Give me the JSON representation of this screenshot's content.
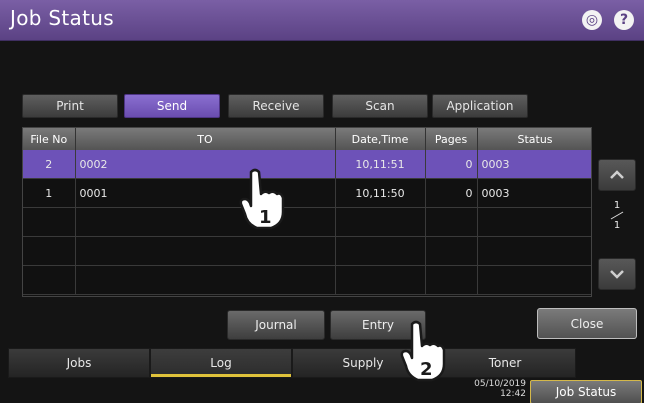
{
  "window": {
    "title": "Job Status",
    "icons": [
      {
        "name": "globe-icon",
        "glyph": "◎"
      },
      {
        "name": "help-icon",
        "glyph": "?"
      }
    ]
  },
  "top_tabs": [
    {
      "label": "Print",
      "active": false
    },
    {
      "label": "Send",
      "active": true
    },
    {
      "label": "Receive",
      "active": false
    },
    {
      "label": "Scan",
      "active": false
    },
    {
      "label": "Application",
      "active": false
    }
  ],
  "table": {
    "columns": [
      "File No",
      "TO",
      "Date,Time",
      "Pages",
      "Status"
    ],
    "rows": [
      {
        "file_no": "2",
        "to": "0002",
        "date_time": "10,11:51",
        "pages": "0",
        "status": "0003",
        "selected": true
      },
      {
        "file_no": "1",
        "to": "0001",
        "date_time": "10,11:50",
        "pages": "0",
        "status": "0003",
        "selected": false
      }
    ],
    "empty_rows": 3
  },
  "pager": {
    "current": "1",
    "total": "1"
  },
  "actions": {
    "journal": "Journal",
    "entry": "Entry",
    "close": "Close"
  },
  "bottom_tabs": [
    {
      "label": "Jobs",
      "active": false
    },
    {
      "label": "Log",
      "active": true
    },
    {
      "label": "Supply",
      "active": false
    },
    {
      "label": "Toner",
      "active": false
    }
  ],
  "status_bar": {
    "date": "05/10/2019",
    "time": "12:42",
    "job_status_button": "Job Status"
  },
  "callouts": [
    {
      "number": "1",
      "name": "pointer-hand-icon"
    },
    {
      "number": "2",
      "name": "pointer-hand-icon"
    }
  ],
  "colors": {
    "accent_purple": "#6d52b8",
    "title_purple": "#6a4f96",
    "active_underline": "#e0c33b",
    "job_status_border": "#d4b84a"
  }
}
